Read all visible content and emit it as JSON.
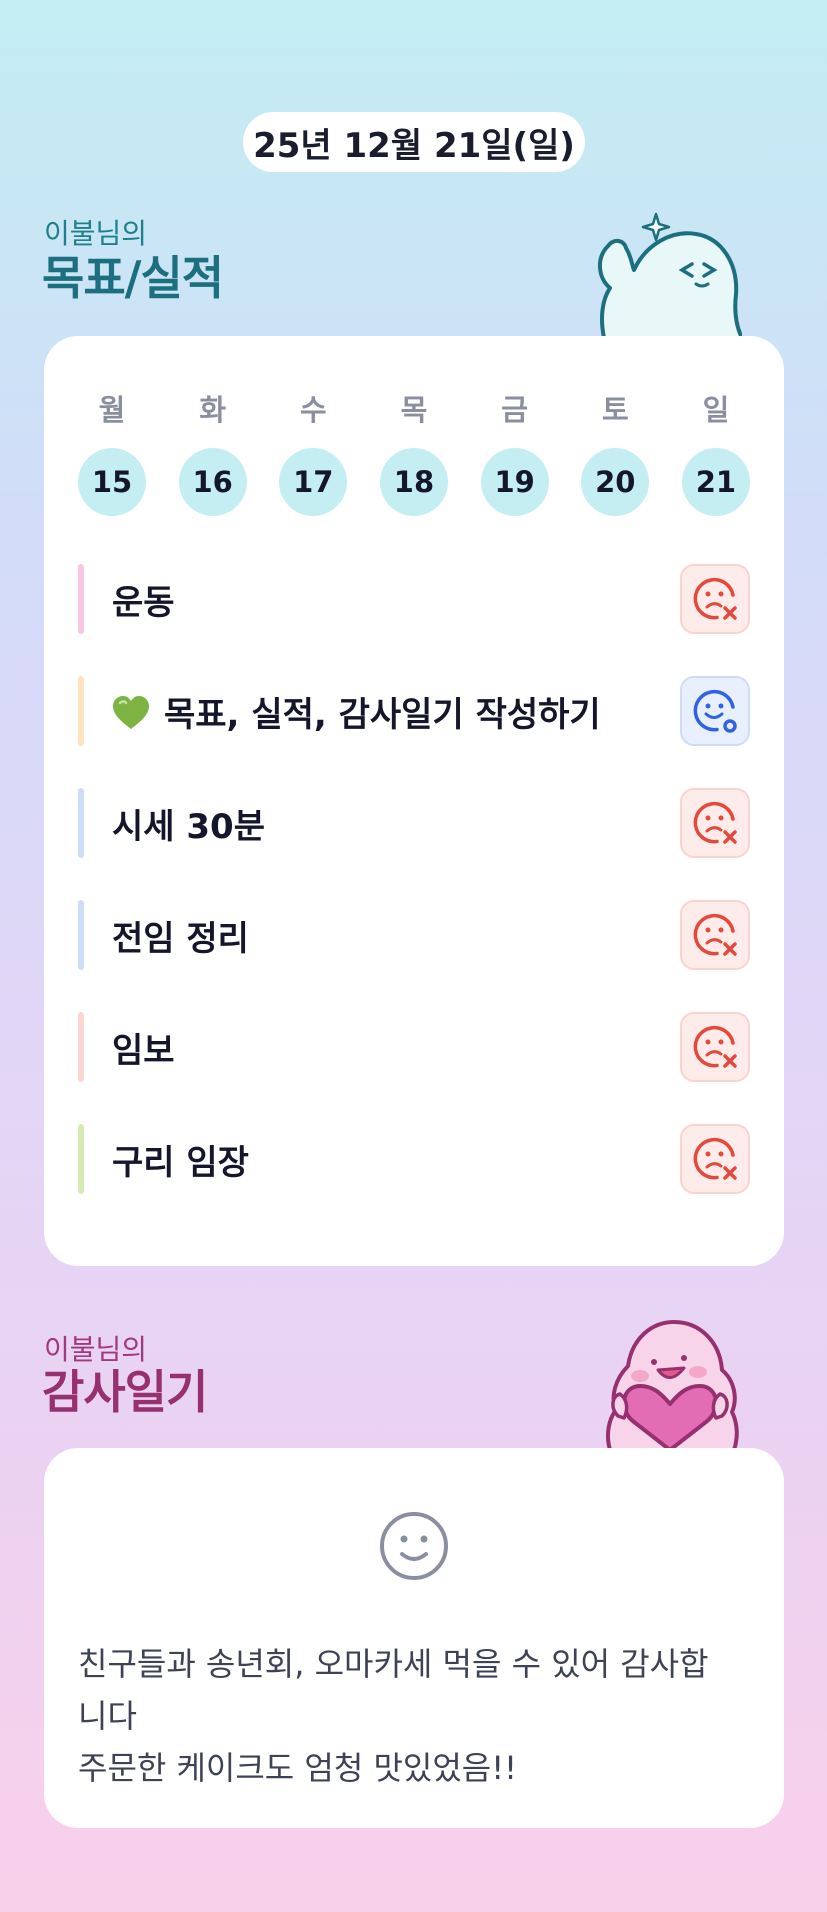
{
  "header": {
    "date": "25년 12월 21일(일)"
  },
  "goals_section": {
    "subtitle": "이불님의",
    "title": "목표/실적",
    "days": [
      {
        "name": "월",
        "num": "15"
      },
      {
        "name": "화",
        "num": "16"
      },
      {
        "name": "수",
        "num": "17"
      },
      {
        "name": "목",
        "num": "18"
      },
      {
        "name": "금",
        "num": "19"
      },
      {
        "name": "토",
        "num": "20"
      },
      {
        "name": "일",
        "num": "21"
      }
    ],
    "items": [
      {
        "label": "운동",
        "bar_color": "#f7c7e3",
        "status": "fail"
      },
      {
        "label": "목표, 실적, 감사일기 작성하기",
        "emoji": "green-heart",
        "bar_color": "#fde3c0",
        "status": "ok"
      },
      {
        "label": "시세 30분",
        "bar_color": "#cfdcf6",
        "status": "fail"
      },
      {
        "label": "전임 정리",
        "bar_color": "#cfdcf6",
        "status": "fail"
      },
      {
        "label": "임보",
        "bar_color": "#fbd6d3",
        "status": "fail"
      },
      {
        "label": "구리 임장",
        "bar_color": "#d4ebb6",
        "status": "fail"
      }
    ]
  },
  "thanks_section": {
    "subtitle": "이불님의",
    "title": "감사일기",
    "mood_icon": "smile-face-icon",
    "line1": "친구들과 송년회, 오마카세 먹을 수 있어 감사합",
    "line2": "니다",
    "line3": "주문한 케이크도 엄청 맛있었음!!"
  },
  "colors": {
    "accent_teal": "#1b6f7e",
    "accent_magenta": "#96306f",
    "fail_red": "#e4493b",
    "ok_blue": "#2f62e4",
    "day_circle": "#c5eef3"
  }
}
